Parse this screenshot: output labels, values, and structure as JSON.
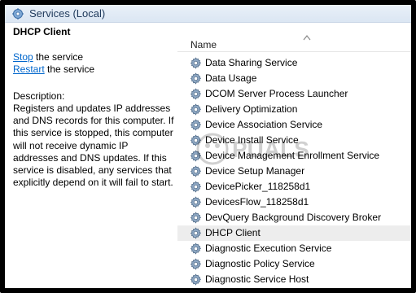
{
  "window": {
    "title": "Services (Local)"
  },
  "details": {
    "service_name": "DHCP Client",
    "stop_link": "Stop",
    "stop_suffix": " the service",
    "restart_link": "Restart",
    "restart_suffix": " the service",
    "description_label": "Description:",
    "description": "Registers and updates IP addresses and DNS records for this computer. If this service is stopped, this computer will not receive dynamic IP addresses and DNS updates. If this service is disabled, any services that explicitly depend on it will fail to start."
  },
  "list": {
    "column_name": "Name",
    "selected": "DHCP Client",
    "items": [
      "Data Sharing Service",
      "Data Usage",
      "DCOM Server Process Launcher",
      "Delivery Optimization",
      "Device Association Service",
      "Device Install Service",
      "Device Management Enrollment Service",
      "Device Setup Manager",
      "DevicePicker_118258d1",
      "DevicesFlow_118258d1",
      "DevQuery Background Discovery Broker",
      "DHCP Client",
      "Diagnostic Execution Service",
      "Diagnostic Policy Service",
      "Diagnostic Service Host"
    ]
  },
  "icons": {
    "title": "services-gear-icon",
    "row": "gear-icon",
    "sort": "sort-ascending-icon"
  },
  "colors": {
    "link": "#0066cc",
    "selected_row": "#ededed",
    "titlebar": "#dbe6f3"
  }
}
